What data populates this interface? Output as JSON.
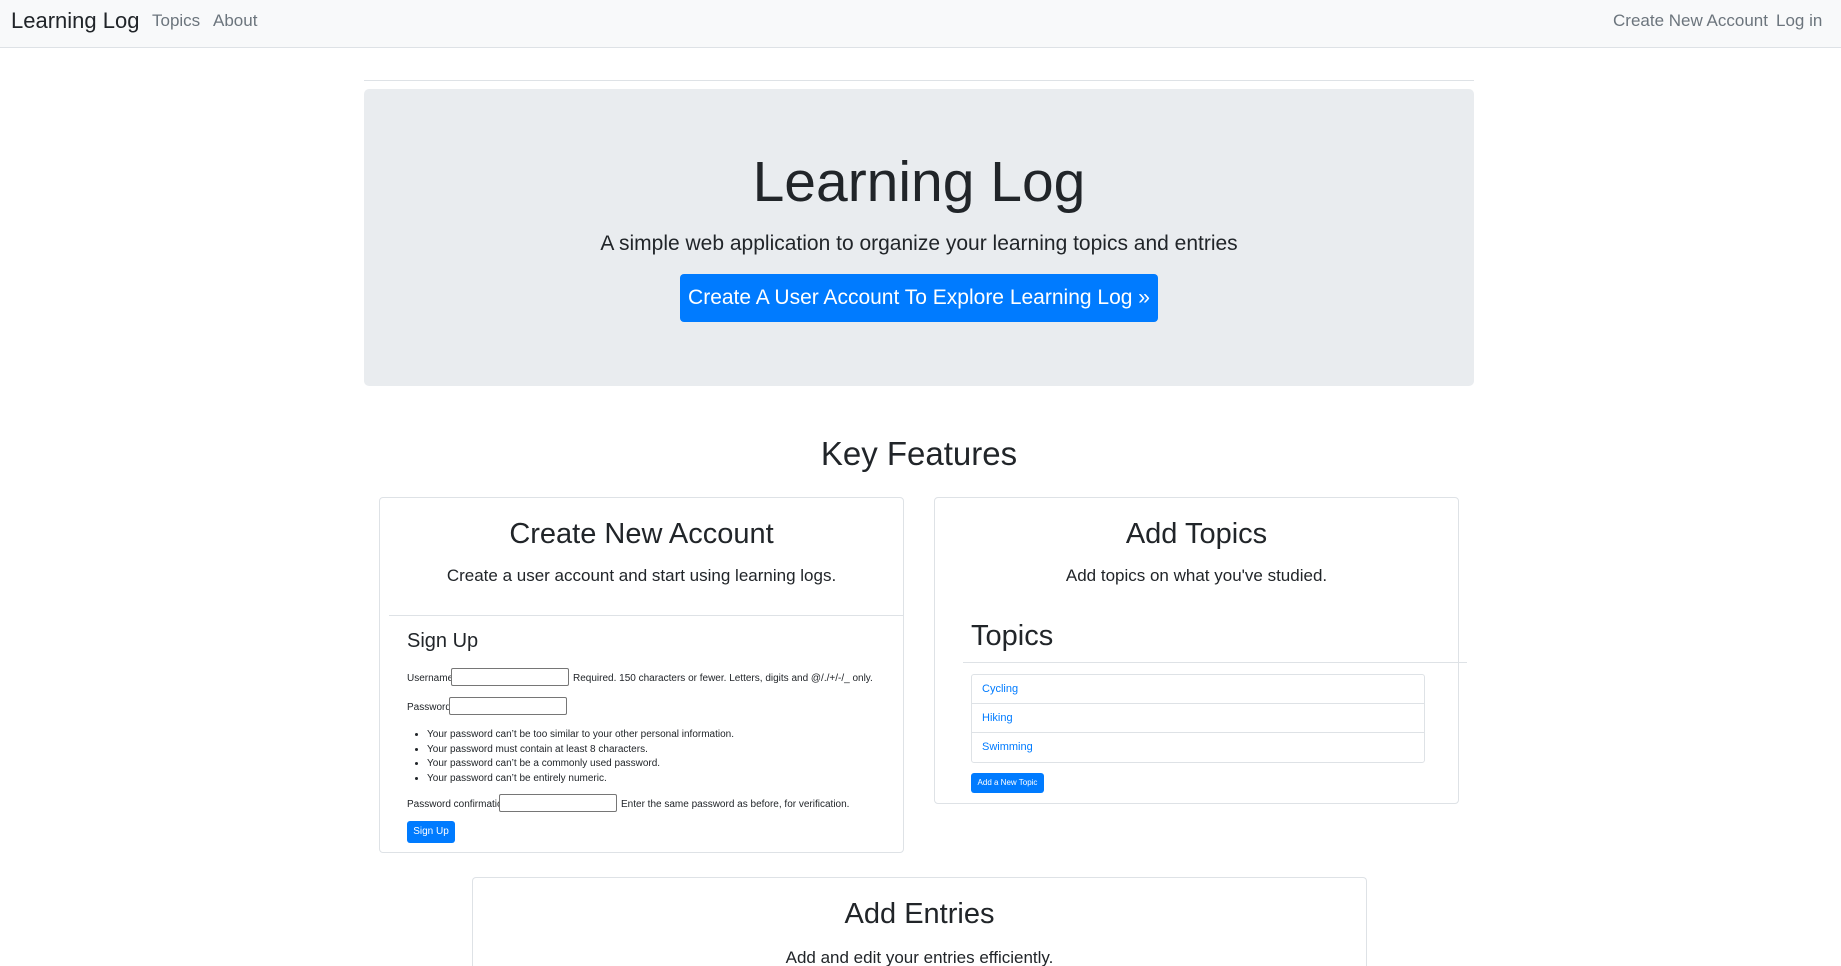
{
  "nav": {
    "brand": "Learning Log",
    "links": [
      "Topics",
      "About"
    ],
    "right_links": [
      "Create New Account",
      "Log in"
    ]
  },
  "jumbotron": {
    "title": "Learning Log",
    "lead": "A simple web application to organize your learning topics and entries",
    "button": "Create A User Account To Explore Learning Log »"
  },
  "features": {
    "title": "Key Features",
    "account_card": {
      "title": "Create New Account",
      "text": "Create a user account and start using learning logs.",
      "form": {
        "heading": "Sign Up",
        "username_label": "Username:",
        "username_help": "Required. 150 characters or fewer. Letters, digits and @/./+/-/_ only.",
        "password_label": "Password:",
        "password_rules": [
          "Your password can’t be too similar to your other personal information.",
          "Your password must contain at least 8 characters.",
          "Your password can’t be a commonly used password.",
          "Your password can’t be entirely numeric."
        ],
        "confirm_label": "Password confirmation:",
        "confirm_help": "Enter the same password as before, for verification.",
        "submit": "Sign Up"
      }
    },
    "topics_card": {
      "title": "Add Topics",
      "text": "Add topics on what you've studied.",
      "heading": "Topics",
      "topics": [
        "Cycling",
        "Hiking",
        "Swimming"
      ],
      "add_button": "Add a New Topic"
    },
    "entries_card": {
      "title": "Add Entries",
      "text": "Add and edit your entries efficiently."
    }
  },
  "colors": {
    "primary": "#007bff",
    "jumbotron_bg": "#e9ecef",
    "navbar_bg": "#f8f9fa"
  }
}
